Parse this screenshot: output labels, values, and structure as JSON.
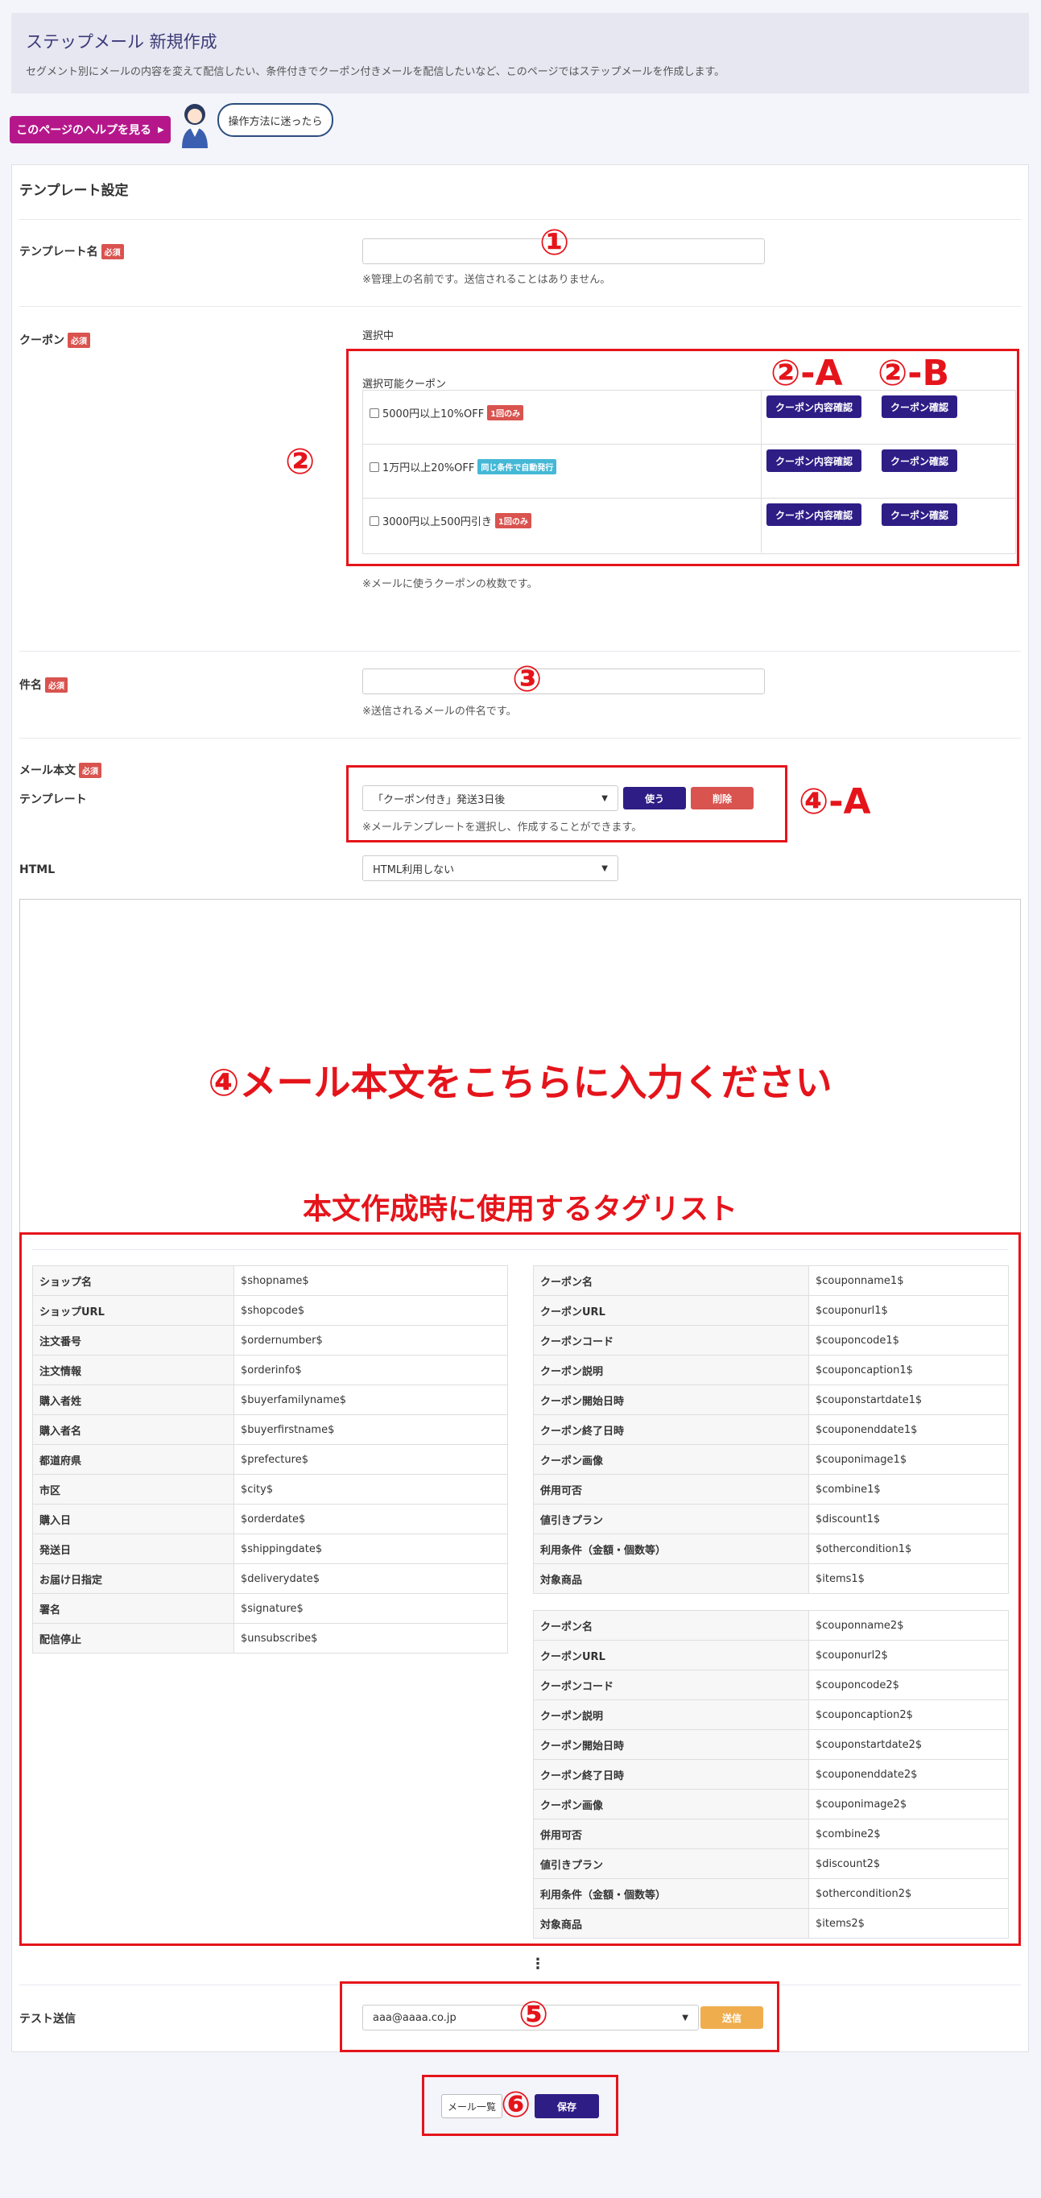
{
  "header": {
    "title": "ステップメール 新規作成",
    "description": "セグメント別にメールの内容を変えて配信したい、条件付きでクーポン付きメールを配信したいなど、このページではステップメールを作成します。"
  },
  "help": {
    "button_label": "このページのヘルプを見る",
    "bubble": "操作方法に迷ったら"
  },
  "card_title": "テンプレート設定",
  "required_badge": "必須",
  "template_name": {
    "label": "テンプレート名",
    "value": "",
    "help": "※管理上の名前です。送信されることはありません。"
  },
  "coupon": {
    "label": "クーポン",
    "selected_label": "選択中",
    "available_label": "選択可能クーポン",
    "help": "※メールに使うクーポンの枚数です。",
    "details_button": "クーポン内容確認",
    "confirm_button": "クーポン確認",
    "items": [
      {
        "name": "5000円以上10%OFF",
        "tag": "1回のみ",
        "tag_color": "#d9534f"
      },
      {
        "name": "1万円以上20%OFF",
        "tag": "同じ条件で自動発行",
        "tag_color": "#45b8d6"
      },
      {
        "name": "3000円以上500円引き",
        "tag": "1回のみ",
        "tag_color": "#d9534f"
      }
    ]
  },
  "subject": {
    "label": "件名",
    "value": "",
    "help": "※送信されるメールの件名です。"
  },
  "body": {
    "label": "メール本文",
    "template_label": "テンプレート",
    "template_selected": "「クーポン付き」発送3日後",
    "use_button": "使う",
    "delete_button": "削除",
    "template_help": "※メールテンプレートを選択し、作成することができます。",
    "html_label": "HTML",
    "html_selected": "HTML利用しない"
  },
  "tags_left": [
    [
      "ショップ名",
      "$shopname$"
    ],
    [
      "ショップURL",
      "$shopcode$"
    ],
    [
      "注文番号",
      "$ordernumber$"
    ],
    [
      "注文情報",
      "$orderinfo$"
    ],
    [
      "購入者姓",
      "$buyerfamilyname$"
    ],
    [
      "購入者名",
      "$buyerfirstname$"
    ],
    [
      "都道府県",
      "$prefecture$"
    ],
    [
      "市区",
      "$city$"
    ],
    [
      "購入日",
      "$orderdate$"
    ],
    [
      "発送日",
      "$shippingdate$"
    ],
    [
      "お届け日指定",
      "$deliverydate$"
    ],
    [
      "署名",
      "$signature$"
    ],
    [
      "配信停止",
      "$unsubscribe$"
    ]
  ],
  "tags_coupon1": [
    [
      "クーポン名",
      "$couponname1$"
    ],
    [
      "クーポンURL",
      "$couponurl1$"
    ],
    [
      "クーポンコード",
      "$couponcode1$"
    ],
    [
      "クーポン説明",
      "$couponcaption1$"
    ],
    [
      "クーポン開始日時",
      "$couponstartdate1$"
    ],
    [
      "クーポン終了日時",
      "$couponenddate1$"
    ],
    [
      "クーポン画像",
      "$couponimage1$"
    ],
    [
      "併用可否",
      "$combine1$"
    ],
    [
      "値引きプラン",
      "$discount1$"
    ],
    [
      "利用条件（金額・個数等）",
      "$othercondition1$"
    ],
    [
      "対象商品",
      "$items1$"
    ]
  ],
  "tags_coupon2": [
    [
      "クーポン名",
      "$couponname2$"
    ],
    [
      "クーポンURL",
      "$couponurl2$"
    ],
    [
      "クーポンコード",
      "$couponcode2$"
    ],
    [
      "クーポン説明",
      "$couponcaption2$"
    ],
    [
      "クーポン開始日時",
      "$couponstartdate2$"
    ],
    [
      "クーポン終了日時",
      "$couponenddate2$"
    ],
    [
      "クーポン画像",
      "$couponimage2$"
    ],
    [
      "併用可否",
      "$combine2$"
    ],
    [
      "値引きプラン",
      "$discount2$"
    ],
    [
      "利用条件（金額・個数等）",
      "$othercondition2$"
    ],
    [
      "対象商品",
      "$items2$"
    ]
  ],
  "test_send": {
    "label": "テスト送信",
    "email": "aaa@aaaa.co.jp",
    "send_button": "送信"
  },
  "footer": {
    "list_button": "メール一覧",
    "save_button": "保存"
  },
  "annotations": {
    "n1": "①",
    "n2": "②",
    "n2a": "②-A",
    "n2b": "②-B",
    "n3": "③",
    "n4a": "④-A",
    "n4_text": "④メール本文をこちらに入力ください",
    "tag_list_title": "本文作成時に使用するタグリスト",
    "n5": "⑤",
    "n6": "⑥"
  },
  "colors": {
    "accent": "#2f1d86",
    "help_button": "#b5178b",
    "required": "#d9534f",
    "annotation": "#e5141b",
    "send": "#f0ad4e"
  }
}
